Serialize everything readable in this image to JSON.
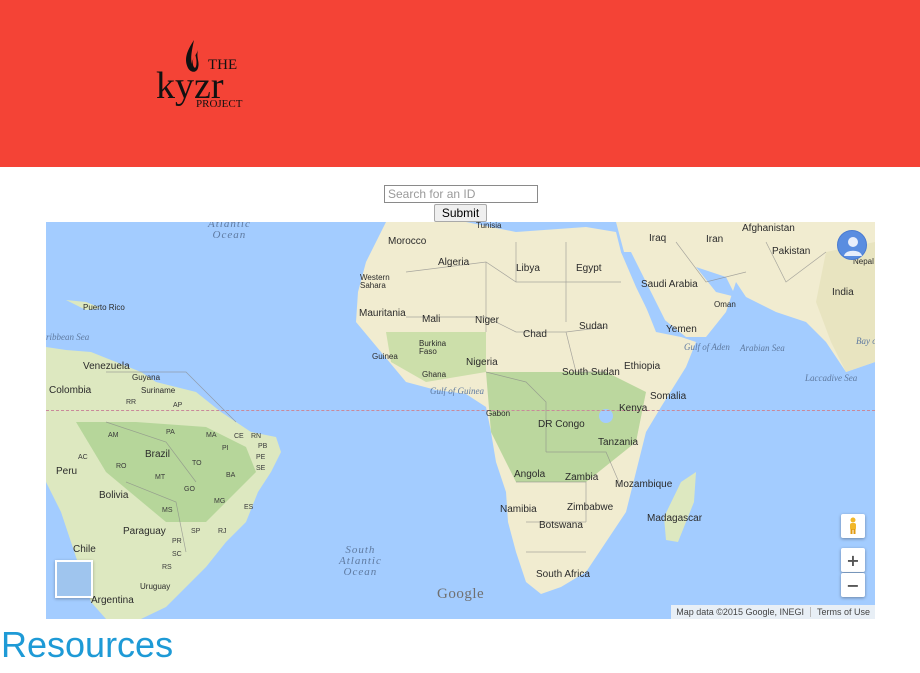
{
  "header": {
    "logo_text_top": "THE",
    "logo_text_main": "kyzr",
    "logo_text_bottom": "PROJECT",
    "background_color": "#f44336"
  },
  "search": {
    "placeholder": "Search for an ID",
    "value": "",
    "submit_label": "Submit"
  },
  "map": {
    "ocean_labels": {
      "atlantic_north": "Atlantic\nOcean",
      "atlantic_south": "South\nAtlantic\nOcean",
      "caribbean": "ribbean Sea",
      "gulf_guinea": "Gulf of Guinea",
      "gulf_aden": "Gulf of Aden",
      "arabian_sea": "Arabian Sea",
      "laccadive": "Laccadive Sea",
      "bay": "Bay o"
    },
    "countries": {
      "morocco": "Morocco",
      "tunisia": "Tunisia",
      "algeria": "Algeria",
      "libya": "Libya",
      "egypt": "Egypt",
      "iraq": "Iraq",
      "iran": "Iran",
      "afghanistan": "Afghanistan",
      "pakistan": "Pakistan",
      "nepal": "Nepal",
      "india": "India",
      "saudi_arabia": "Saudi Arabia",
      "oman": "Oman",
      "yemen": "Yemen",
      "western_sahara": "Western\nSahara",
      "mauritania": "Mauritania",
      "mali": "Mali",
      "niger": "Niger",
      "chad": "Chad",
      "sudan": "Sudan",
      "ethiopia": "Ethiopia",
      "south_sudan": "South Sudan",
      "nigeria": "Nigeria",
      "guinea": "Guinea",
      "burkina_faso": "Burkina\nFaso",
      "ghana": "Ghana",
      "somalia": "Somalia",
      "kenya": "Kenya",
      "gabon": "Gabon",
      "dr_congo": "DR Congo",
      "tanzania": "Tanzania",
      "angola": "Angola",
      "zambia": "Zambia",
      "mozambique": "Mozambique",
      "madagascar": "Madagascar",
      "namibia": "Namibia",
      "zimbabwe": "Zimbabwe",
      "botswana": "Botswana",
      "south_africa": "South Africa",
      "puerto_rico": "Puerto Rico",
      "venezuela": "Venezuela",
      "guyana": "Guyana",
      "suriname": "Suriname",
      "colombia": "Colombia",
      "peru": "Peru",
      "brazil": "Brazil",
      "bolivia": "Bolivia",
      "paraguay": "Paraguay",
      "chile": "Chile",
      "uruguay": "Uruguay",
      "argentina": "Argentina"
    },
    "states": {
      "rr": "RR",
      "ap": "AP",
      "am": "AM",
      "pa": "PA",
      "ma": "MA",
      "ce": "CE",
      "rn": "RN",
      "pb": "PB",
      "pi": "PI",
      "pe": "PE",
      "ac": "AC",
      "ro": "RO",
      "to": "TO",
      "se": "SE",
      "mt": "MT",
      "ba": "BA",
      "go": "GO",
      "mg": "MG",
      "es": "ES",
      "ms": "MS",
      "sp": "SP",
      "rj": "RJ",
      "pr": "PR",
      "sc": "SC",
      "rs": "RS"
    },
    "google_label": "Google",
    "attribution": "Map data ©2015 Google, INEGI",
    "terms": "Terms of Use",
    "zoom_in": "+",
    "zoom_out": "−"
  },
  "resources": {
    "heading": "Resources",
    "color": "#1e9ad6"
  }
}
